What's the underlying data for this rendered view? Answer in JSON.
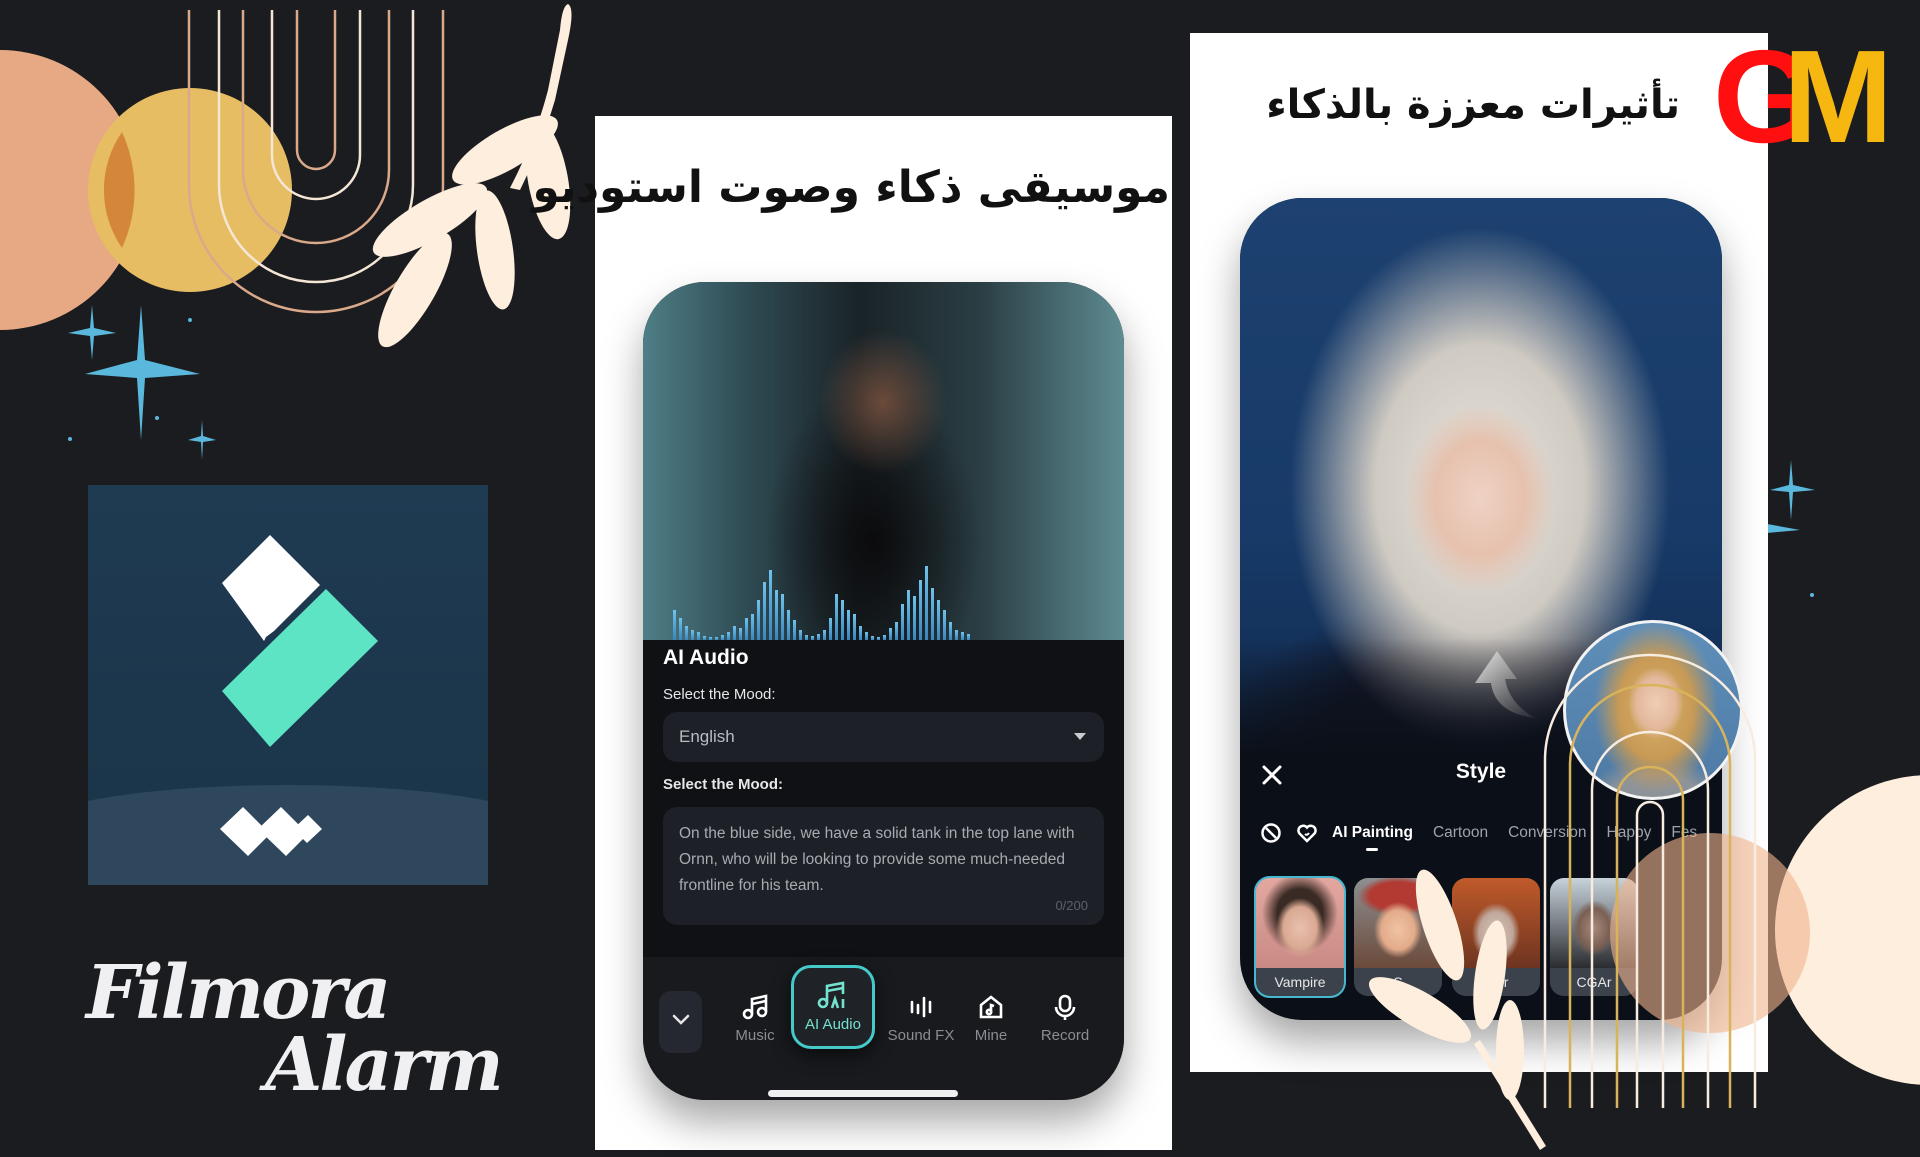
{
  "brand": {
    "line1": "Filmora",
    "line2": "Alarm",
    "logo_text_g": "G",
    "logo_text_m": "M",
    "logo_colors": {
      "g": "#ff0f0f",
      "m": "#f7b711"
    }
  },
  "cards": {
    "middle_title": "موسيقى ذكاء وصوت استوديو",
    "right_title": "تأثيرات معززة بالذكاء"
  },
  "audio_screen": {
    "title": "AI Audio",
    "mood_label_1": "Select the Mood:",
    "language_select": {
      "value": "English",
      "icon": "caret-down-icon"
    },
    "mood_label_2": "Select the Mood:",
    "text_input": {
      "value": "On the blue side, we have a solid tank in the top lane with Ornn, who will be looking to provide some much-needed frontline for his team.",
      "counter": "0/200"
    },
    "bottom_tabs": [
      {
        "label": "Music",
        "icon": "music-note-icon",
        "active": false
      },
      {
        "label": "AI Audio",
        "icon": "ai-music-icon",
        "active": true
      },
      {
        "label": "Sound FX",
        "icon": "sound-wave-icon",
        "active": false
      },
      {
        "label": "Mine",
        "icon": "home-music-icon",
        "active": false
      },
      {
        "label": "Record",
        "icon": "microphone-icon",
        "active": false
      }
    ],
    "accent": "#45c9c9"
  },
  "style_screen": {
    "title": "Style",
    "tabs": [
      {
        "label": "AI Painting",
        "active": true
      },
      {
        "label": "Cartoon",
        "active": false
      },
      {
        "label": "Conversion",
        "active": false
      },
      {
        "label": "Happy",
        "active": false
      },
      {
        "label": "Fes",
        "active": false
      }
    ],
    "thumbnails": [
      {
        "label": "Vampire",
        "selected": true
      },
      {
        "label": "S",
        "selected": false
      },
      {
        "label": "urer",
        "selected": false
      },
      {
        "label": "CGAr",
        "selected": false
      }
    ]
  }
}
